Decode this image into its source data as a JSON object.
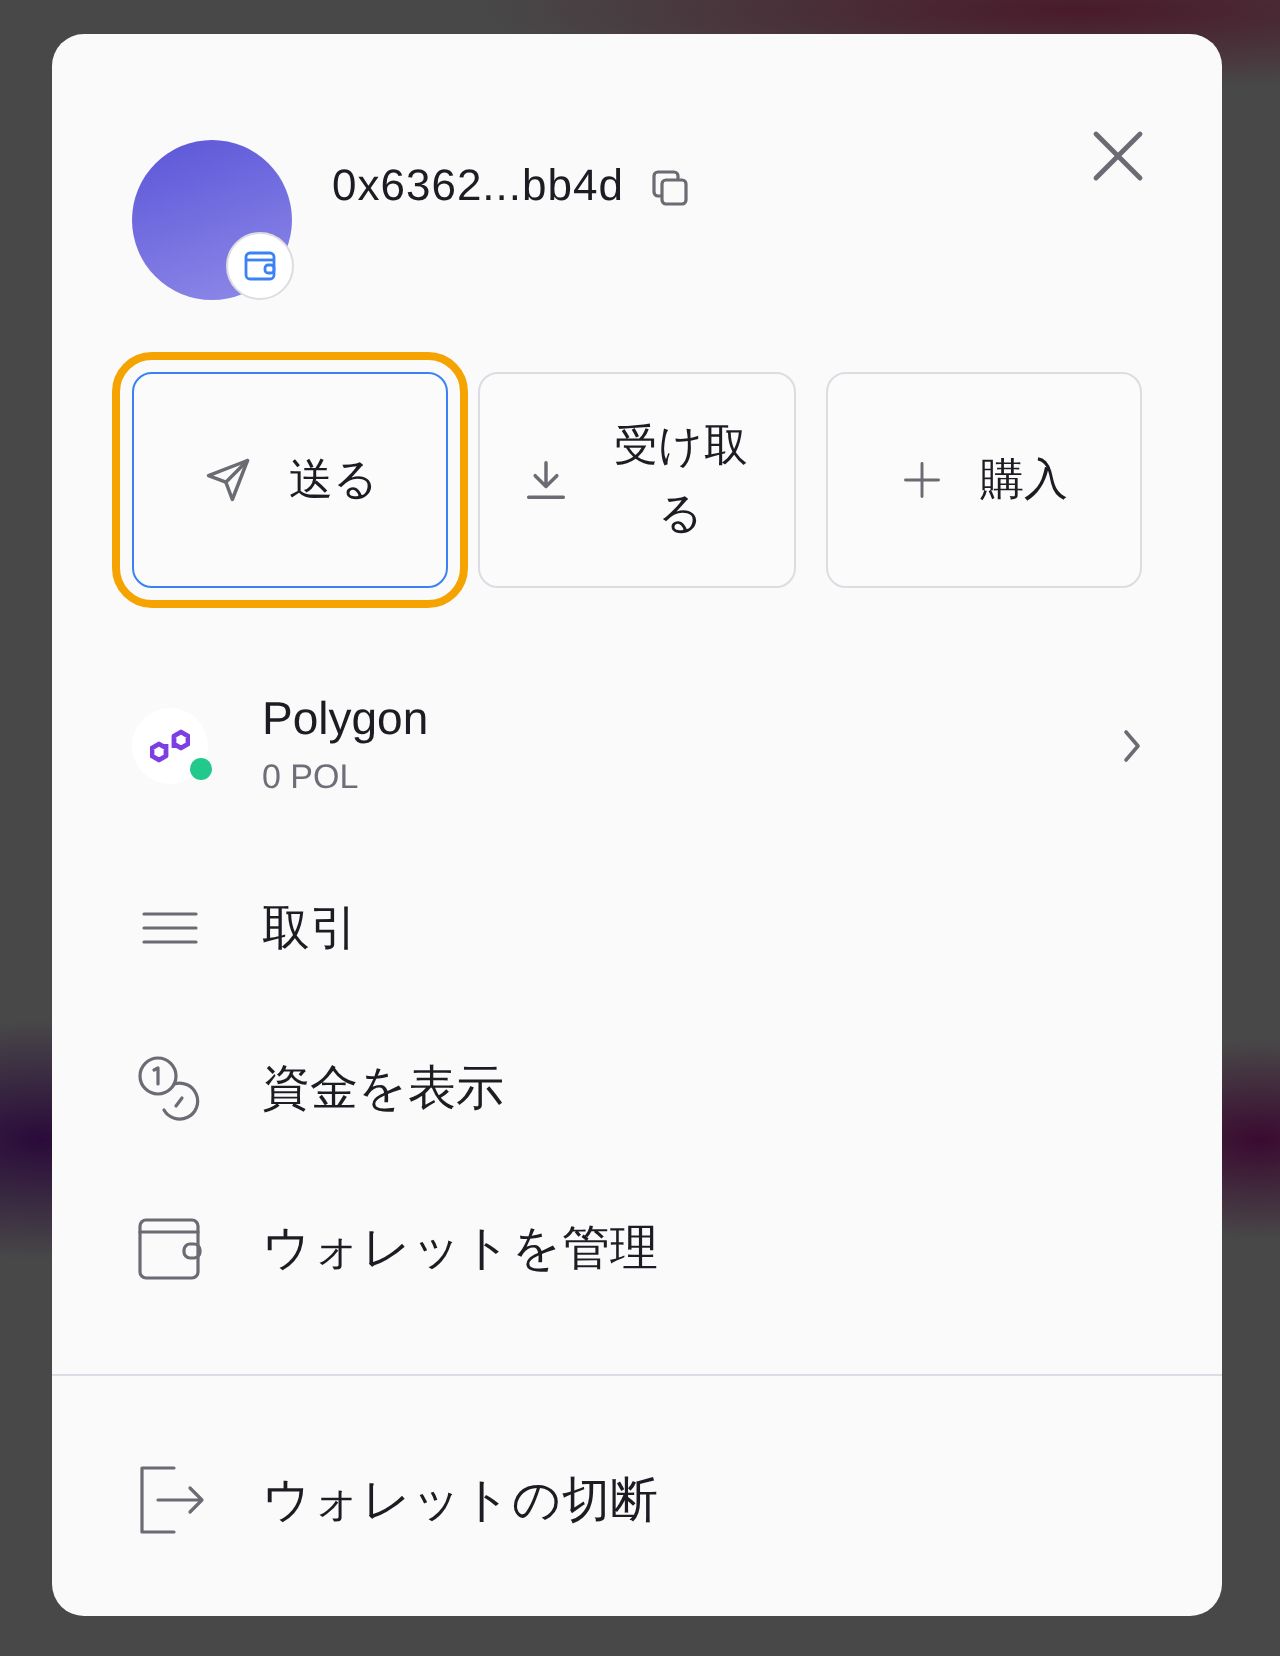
{
  "account": {
    "address": "0x6362...bb4d"
  },
  "actions": [
    {
      "kind": "send",
      "label": "送る",
      "focused": true
    },
    {
      "kind": "receive",
      "label": "受け取る",
      "focused": false
    },
    {
      "kind": "buy",
      "label": "購入",
      "focused": false
    }
  ],
  "network": {
    "name": "Polygon",
    "balance": "0 POL",
    "connected": true
  },
  "menu": [
    {
      "kind": "transactions",
      "label": "取引"
    },
    {
      "kind": "funds",
      "label": "資金を表示"
    },
    {
      "kind": "wallet",
      "label": "ウォレットを管理"
    }
  ],
  "footer": {
    "kind": "disconnect",
    "label": "ウォレットの切断"
  }
}
